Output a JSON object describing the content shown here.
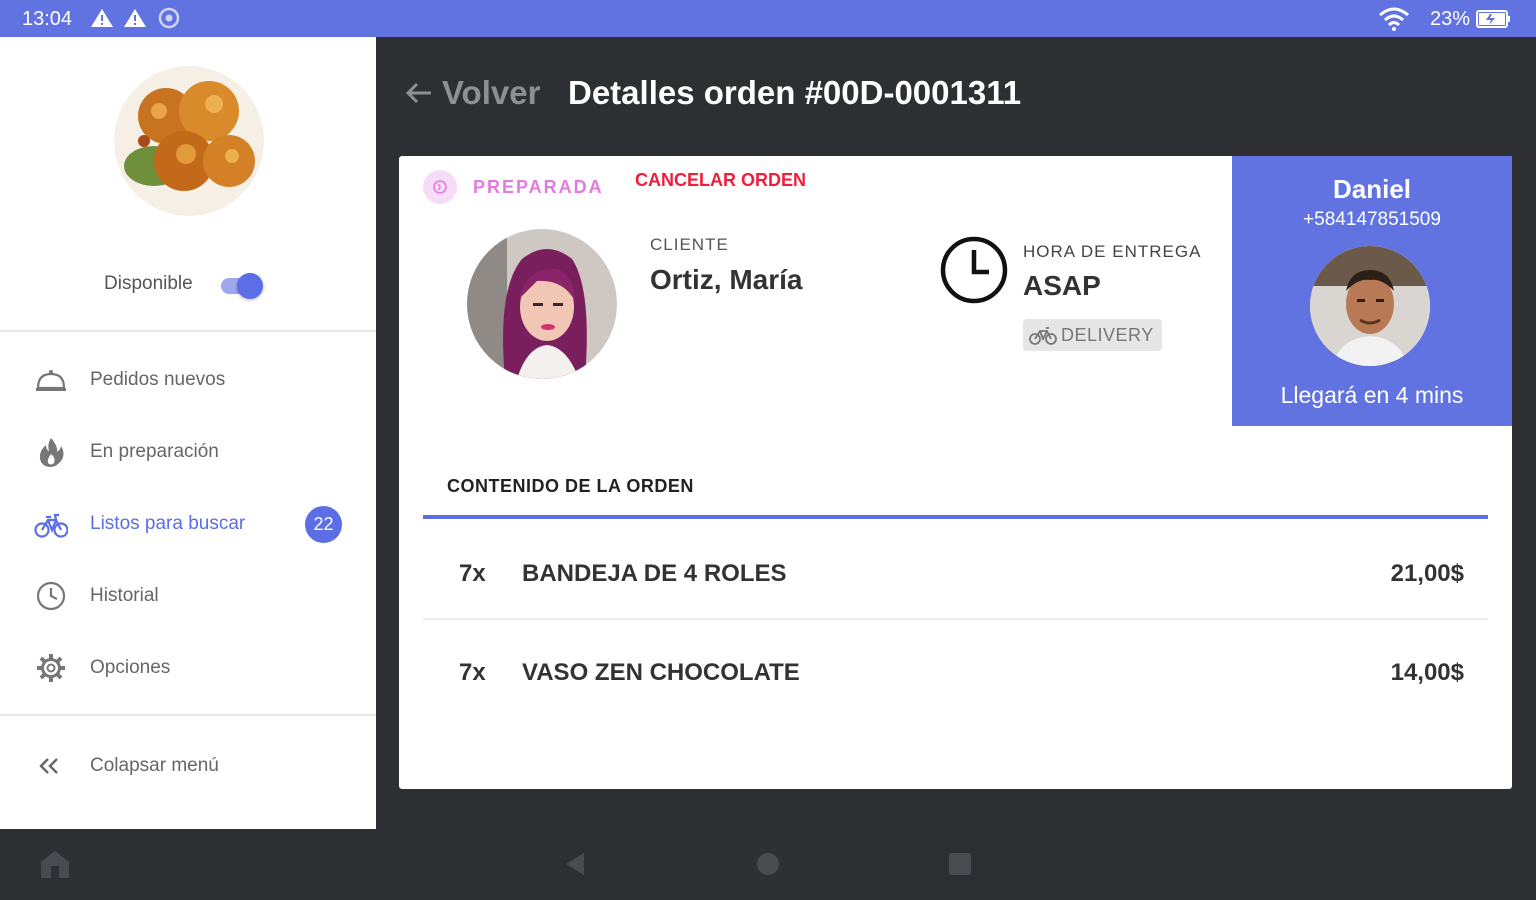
{
  "status_bar": {
    "time": "13:04",
    "battery": "23%"
  },
  "sidebar": {
    "availability_label": "Disponible",
    "availability_on": true,
    "items": [
      {
        "label": "Pedidos nuevos",
        "icon": "cloche-icon"
      },
      {
        "label": "En preparación",
        "icon": "flame-icon"
      },
      {
        "label": "Listos para buscar",
        "icon": "bicycle-icon",
        "badge": "22",
        "active": true
      },
      {
        "label": "Historial",
        "icon": "clock-icon"
      },
      {
        "label": "Opciones",
        "icon": "gear-icon"
      }
    ],
    "collapse_label": "Colapsar menú"
  },
  "header": {
    "back_label": "Volver",
    "title": "Detalles orden #00D-0001311"
  },
  "order": {
    "status": "PREPARADA",
    "cancel_label": "CANCELAR ORDEN",
    "client_label": "CLIENTE",
    "client_name": "Ortiz, María",
    "delivery_label": "HORA DE ENTREGA",
    "delivery_time": "ASAP",
    "delivery_type": "DELIVERY",
    "driver": {
      "name": "Daniel",
      "phone": "+584147851509",
      "eta": "Llegará en 4 mins"
    },
    "contents_label": "CONTENIDO DE LA ORDEN",
    "items": [
      {
        "qty": "7x",
        "name": "BANDEJA DE 4 ROLES",
        "price": "21,00$"
      },
      {
        "qty": "7x",
        "name": "VASO ZEN CHOCOLATE",
        "price": "14,00$"
      }
    ]
  },
  "colors": {
    "accent": "#5b6ee6",
    "status_bar": "#6173e0",
    "status_pink": "#e27be0",
    "cancel_red": "#f21d3a",
    "background": "#2e2f33"
  }
}
